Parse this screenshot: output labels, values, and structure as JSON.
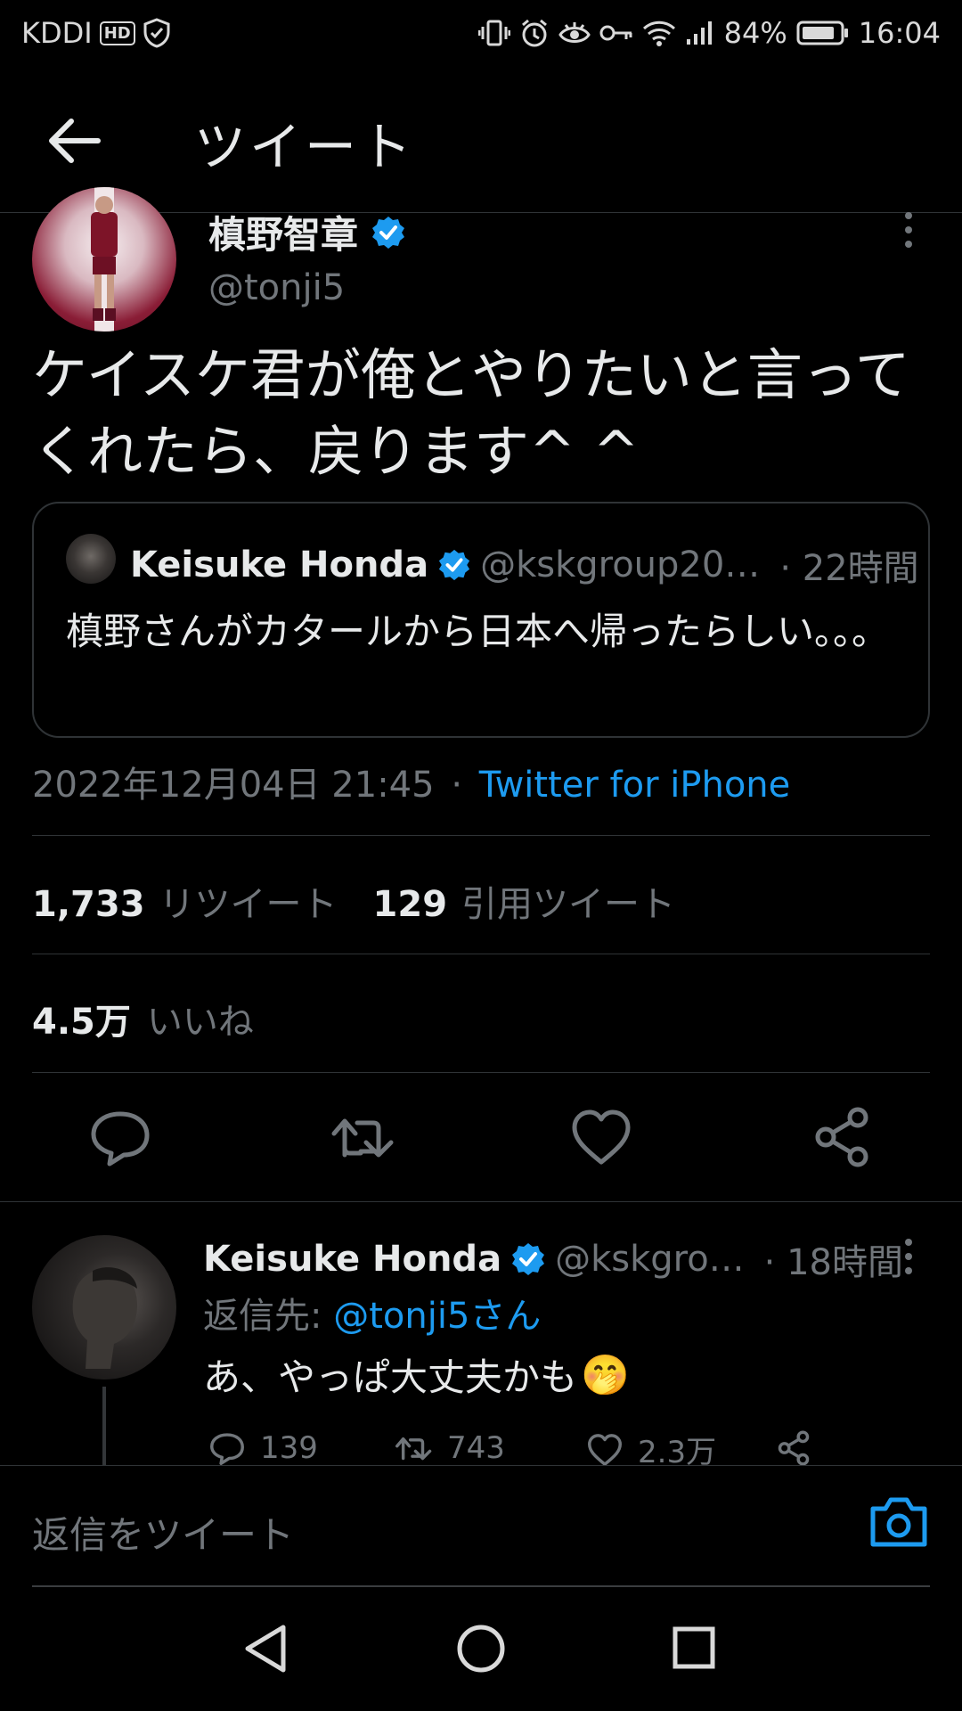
{
  "status_bar": {
    "carrier": "KDDI",
    "hd_badge": "HD",
    "battery": "84%",
    "time": "16:04"
  },
  "header": {
    "title": "ツイート"
  },
  "tweet": {
    "author_name": "槙野智章",
    "author_handle": "@tonji5",
    "text": "ケイスケ君が俺とやりたいと言ってくれたら、戻ります^ ^",
    "timestamp": "2022年12月04日 21:45",
    "separator": "·",
    "source": "Twitter for iPhone"
  },
  "quote": {
    "author_name": "Keisuke Honda",
    "author_handle": "@kskgroup20…",
    "time": "· 22時間",
    "text": "槙野さんがカタールから日本へ帰ったらしい。。。"
  },
  "stats": {
    "retweets": "1,733",
    "retweets_label": "リツイート",
    "quotes": "129",
    "quotes_label": "引用ツイート",
    "likes": "4.5万",
    "likes_label": "いいね"
  },
  "reply": {
    "author_name": "Keisuke Honda",
    "author_handle": "@kskgro…",
    "time": "· 18時間",
    "reply_to_prefix": "返信先: ",
    "reply_to_user": "@tonji5さん",
    "text": "あ、やっぱ大丈夫かも",
    "emoji": "🤭",
    "reply_count": "139",
    "retweet_count": "743",
    "like_count": "2.3万"
  },
  "compose": {
    "placeholder": "返信をツイート"
  },
  "colors": {
    "background": "#000000",
    "accent": "#1d9bf0",
    "muted": "#71767b",
    "verified": "#1d9bf0"
  },
  "icons": [
    "back-arrow-icon",
    "verified-badge-icon",
    "more-vertical-icon",
    "reply-icon",
    "retweet-icon",
    "like-icon",
    "share-icon",
    "camera-icon",
    "nav-back-icon",
    "nav-home-icon",
    "nav-recents-icon"
  ]
}
